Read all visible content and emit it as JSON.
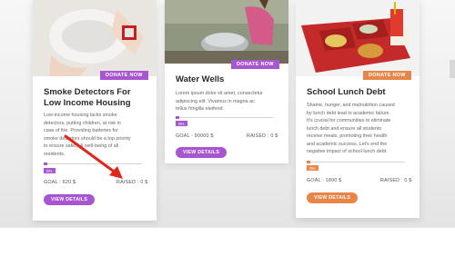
{
  "colors": {
    "purple": "#a855d1",
    "orange": "#e8864a",
    "red_arrow": "#e1261c"
  },
  "cards": [
    {
      "title_line1": "Smoke Detectors For",
      "title_line2": "Low Income Housing",
      "description_lines": [
        "Low-income housing lacks smoke",
        "detectors, putting children, at risk in",
        "case of fire. Providing batteries for",
        "smoke detectors should be a top priority",
        "to ensure safety & well-being of all",
        "residents."
      ],
      "donate_label": "DONATE NOW",
      "percent_label": "0%",
      "goal": "GOAL : 620 $",
      "raised": "RAISED : 0 $",
      "details_label": "VIEW DETAILS",
      "accent": "purple"
    },
    {
      "title_line1": "Water Wells",
      "description_lines": [
        "Lorem ipsum dolor sit amet, consectetur",
        "adipiscing elit. Vivamus in magna ac",
        "tellus fringilla eleifend."
      ],
      "donate_label": "DONATE NOW",
      "percent_label": "0%",
      "goal": "GOAL : 90000 $",
      "raised": "RAISED : 0 $",
      "details_label": "VIEW DETAILS",
      "accent": "purple"
    },
    {
      "title_line1": "School Lunch Debt",
      "description_lines": [
        "Shame, hunger, and malnutrition caused",
        "by lunch debt lead to academic failure.",
        "It's crucial for communities to eliminate",
        "lunch debt and ensure all students",
        "receive meals, promoting their health",
        "and academic success. Let's end the",
        "negative impact of school lunch debt."
      ],
      "donate_label": "DONATE NOW",
      "percent_label": "0%",
      "goal": "GOAL : 1800 $",
      "raised": "RAISED : 0 $",
      "details_label": "VIEW DETAILS",
      "accent": "orange"
    }
  ],
  "images": [
    "smoke-detector-photo",
    "water-well-photo",
    "lunch-tray-photo"
  ],
  "annotation": {
    "icon": "red-arrow-annotation"
  }
}
